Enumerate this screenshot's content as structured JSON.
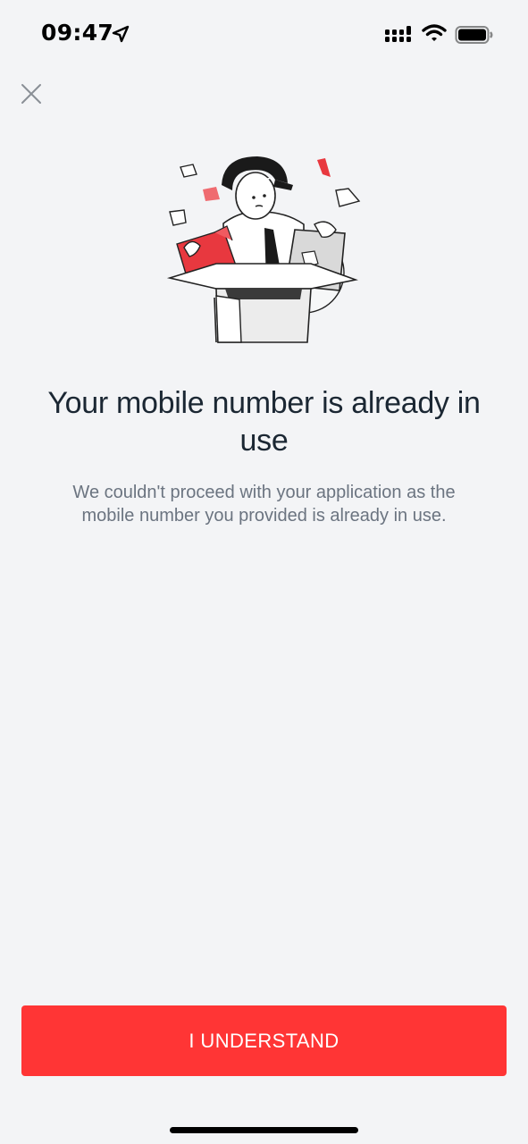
{
  "status_bar": {
    "time": "09:47",
    "icons": [
      "location-arrow-icon",
      "signal-icon",
      "wifi-icon",
      "battery-icon"
    ]
  },
  "close_button": {
    "icon": "close-icon"
  },
  "illustration": {
    "icon": "person-in-box-with-papers-illustration"
  },
  "content": {
    "title": "Your mobile number is already in use",
    "description": "We couldn't proceed with your application as the mobile number you provided is already in use."
  },
  "actions": {
    "primary_label": "I UNDERSTAND"
  },
  "colors": {
    "background": "#f3f4f6",
    "accent": "#ff3535",
    "title_text": "#1b2733",
    "body_text": "#6b7480"
  }
}
